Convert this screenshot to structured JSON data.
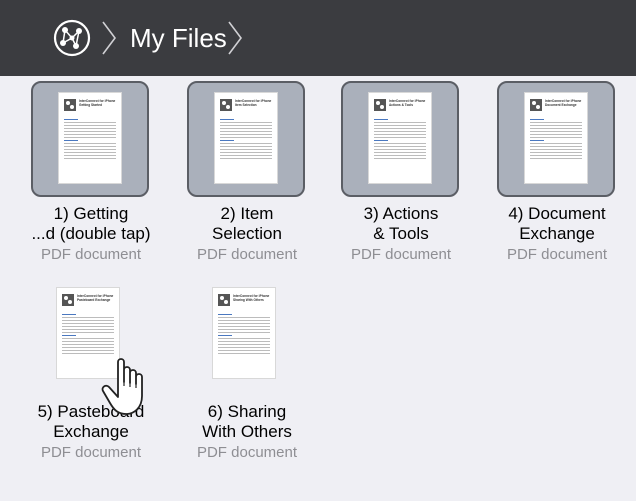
{
  "header": {
    "title": "My Files",
    "globe_icon": "globe-network-icon",
    "separator_icon": "chevron-right-icon"
  },
  "files": [
    {
      "name_line1": "1) Getting",
      "name_line2": "...d (double tap)",
      "type": "PDF document",
      "doc_title_line1": "InterConnect for iPhone",
      "doc_title_line2": "Getting Started",
      "selected": true
    },
    {
      "name_line1": "2) Item",
      "name_line2": "Selection",
      "type": "PDF document",
      "doc_title_line1": "InterConnect for iPhone",
      "doc_title_line2": "Item Selection",
      "selected": true
    },
    {
      "name_line1": "3) Actions",
      "name_line2": "& Tools",
      "type": "PDF document",
      "doc_title_line1": "InterConnect for iPhone",
      "doc_title_line2": "Actions & Tools",
      "selected": true
    },
    {
      "name_line1": "4) Document",
      "name_line2": "Exchange",
      "type": "PDF document",
      "doc_title_line1": "InterConnect for iPhone",
      "doc_title_line2": "Document Exchange",
      "selected": true
    },
    {
      "name_line1": "5) Pasteboard",
      "name_line2": "Exchange",
      "type": "PDF document",
      "doc_title_line1": "InterConnect for iPhone",
      "doc_title_line2": "Pasteboard Exchange",
      "selected": false
    },
    {
      "name_line1": "6) Sharing",
      "name_line2": "With Others",
      "type": "PDF document",
      "doc_title_line1": "InterConnect for iPhone",
      "doc_title_line2": "Sharing With Others",
      "selected": false
    }
  ],
  "colors": {
    "header_bg": "#3b3c40",
    "selection_bg": "#aab0bb",
    "selection_border": "#5b5e65",
    "page_bg": "#efeff4",
    "secondary_text": "#8e8e93"
  },
  "gesture_icon": "hand-pointer-icon"
}
